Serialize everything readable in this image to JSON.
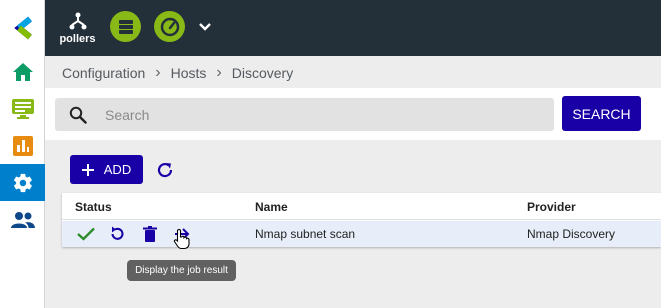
{
  "sidebar": {
    "logo": "centreon-logo-icon",
    "items": [
      {
        "name": "home",
        "icon": "home-icon",
        "color": "#0d9b66"
      },
      {
        "name": "monitoring",
        "icon": "monitor-icon",
        "color": "#88b917"
      },
      {
        "name": "reporting",
        "icon": "bar-chart-icon",
        "color": "#e88b11"
      },
      {
        "name": "configuration",
        "icon": "gear-icon",
        "color": "#ffffff",
        "active": true
      },
      {
        "name": "administration",
        "icon": "users-icon",
        "color": "#0e478a"
      }
    ]
  },
  "header": {
    "pollers_label": "pollers",
    "status_icons": [
      "database-icon",
      "gauge-icon"
    ],
    "status_color": "#88b917",
    "background": "#232f39"
  },
  "breadcrumb": {
    "items": [
      "Configuration",
      "Hosts",
      "Discovery"
    ]
  },
  "search": {
    "placeholder": "Search",
    "value": "",
    "button_label": "SEARCH"
  },
  "toolbar": {
    "add_label": "ADD",
    "refresh_icon": "refresh-icon"
  },
  "table": {
    "columns": [
      "Status",
      "Name",
      "Provider"
    ],
    "rows": [
      {
        "status": "check-icon",
        "name": "Nmap subnet scan",
        "provider": "Nmap Discovery"
      }
    ]
  },
  "tooltip": {
    "text": "Display the job result"
  },
  "colors": {
    "primary": "#1800a6",
    "accent": "#0080cc",
    "success": "#2e8b2e"
  }
}
